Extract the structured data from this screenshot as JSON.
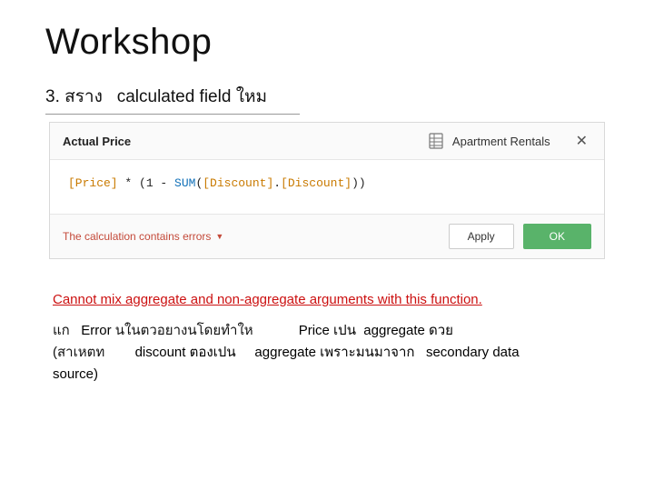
{
  "slide": {
    "title": "Workshop",
    "step_prefix": "3. สราง",
    "step_mid": "calculated field",
    "step_suffix": "ใหม"
  },
  "dialog": {
    "field_name": "Actual Price",
    "datasource": "Apartment Rentals",
    "formula": {
      "f1": "[Price]",
      "op1": " * ",
      "p1": "(1 - ",
      "func": "SUM",
      "p2": "(",
      "f2": "[Discount]",
      "dot": ".",
      "f3": "[Discount]",
      "p3": "))"
    },
    "error_msg": "The calculation contains errors",
    "apply_label": "Apply",
    "ok_label": "OK"
  },
  "notes": {
    "error_detail": "Cannot mix aggregate and non-aggregate arguments with this function.",
    "line1_a": "แก",
    "line1_b": "Error",
    "line1_c": "นในตวอยางนโดยทำให",
    "line1_d": "Price เปน",
    "line1_e": "aggregate ดวย",
    "line2_a": "(สาเหตท",
    "line2_b": "discount ตองเปน",
    "line2_c": "aggregate เพราะมนมาจาก",
    "line2_d": "secondary data",
    "line3": "source)"
  }
}
